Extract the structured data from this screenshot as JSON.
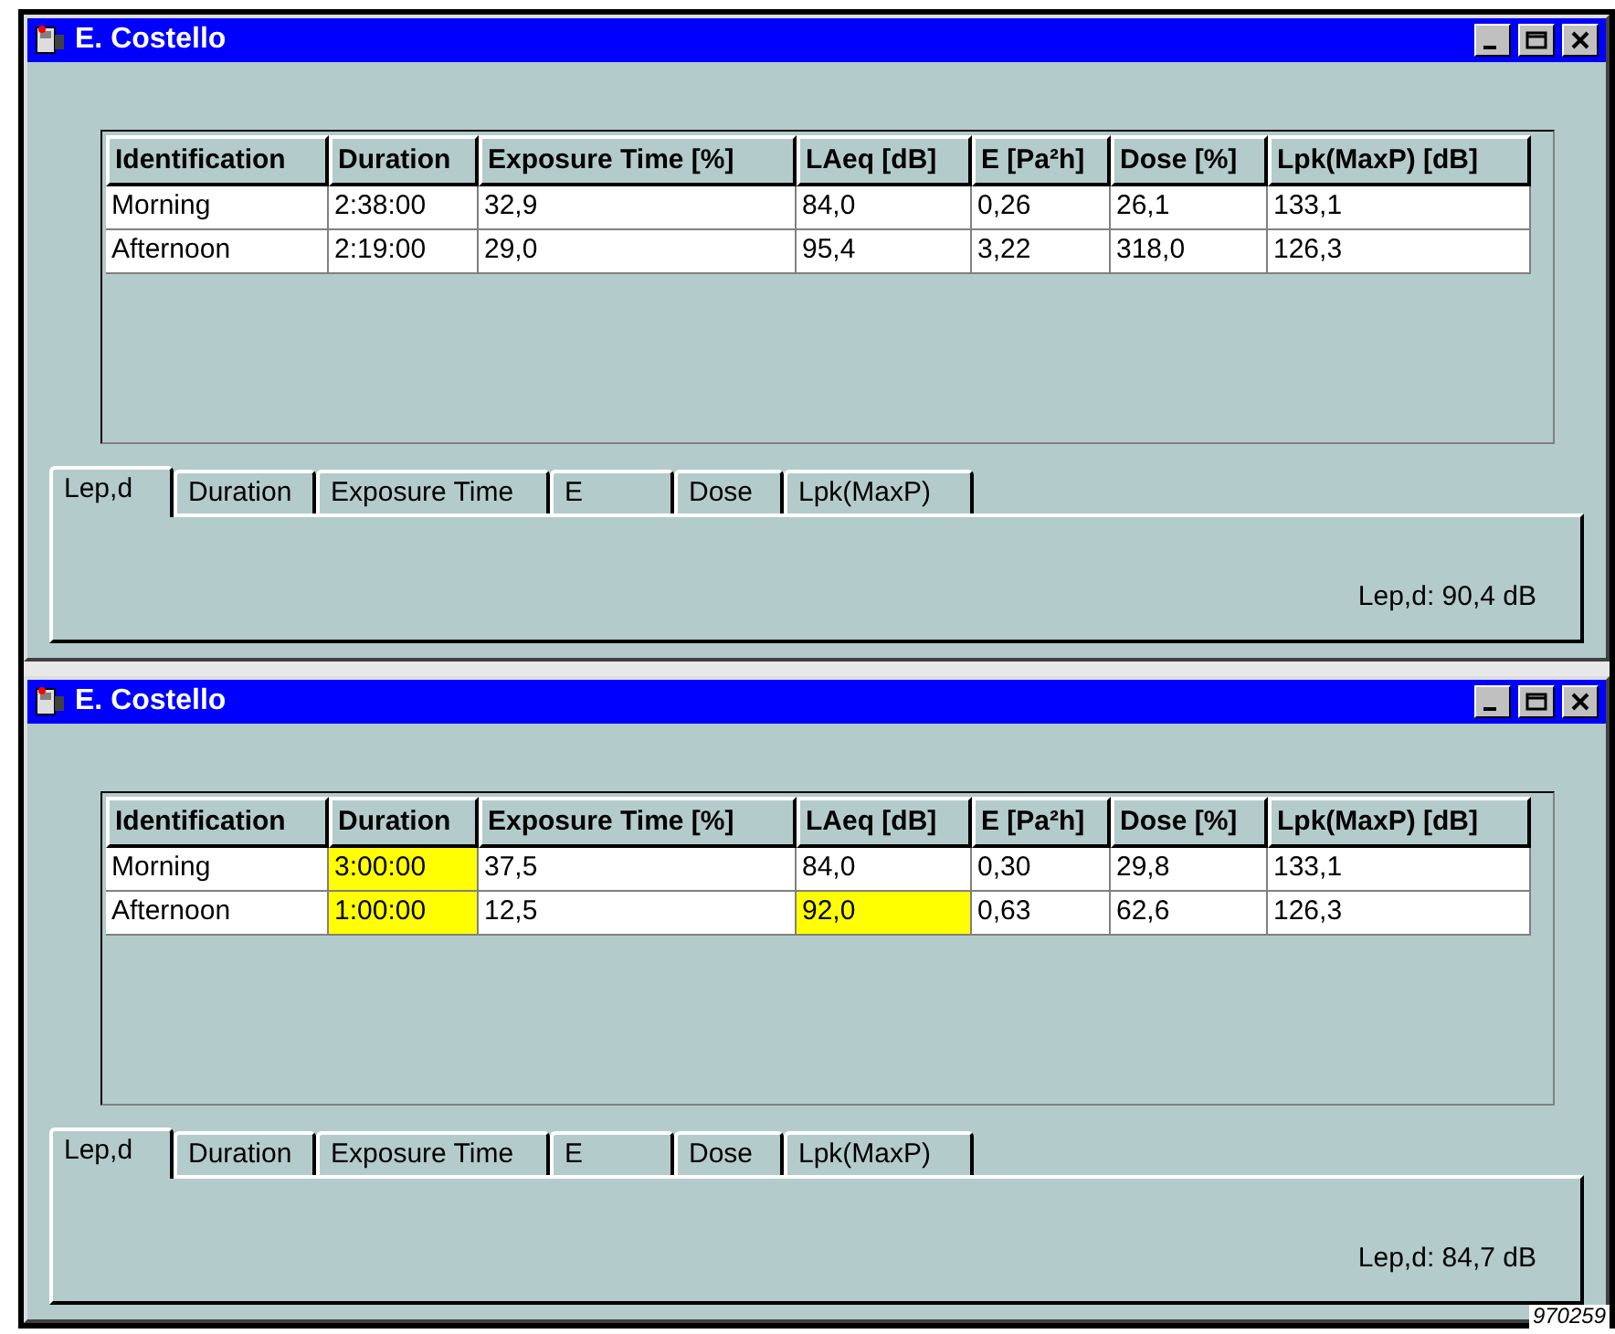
{
  "windows": [
    {
      "title": "E. Costello",
      "table": {
        "columns": [
          "Identification",
          "Duration",
          "Exposure Time [%]",
          "LAeq [dB]",
          "E [Pa²h]",
          "Dose [%]",
          "Lpk(MaxP) [dB]"
        ],
        "rows": [
          {
            "cells": [
              {
                "text": "Morning",
                "highlighted": false
              },
              {
                "text": "2:38:00",
                "highlighted": false
              },
              {
                "text": "32,9",
                "highlighted": false
              },
              {
                "text": "84,0",
                "highlighted": false
              },
              {
                "text": "0,26",
                "highlighted": false
              },
              {
                "text": "26,1",
                "highlighted": false
              },
              {
                "text": "133,1",
                "highlighted": false
              }
            ]
          },
          {
            "cells": [
              {
                "text": "Afternoon",
                "highlighted": false
              },
              {
                "text": "2:19:00",
                "highlighted": false
              },
              {
                "text": "29,0",
                "highlighted": false
              },
              {
                "text": "95,4",
                "highlighted": false
              },
              {
                "text": "3,22",
                "highlighted": false
              },
              {
                "text": "318,0",
                "highlighted": false
              },
              {
                "text": "126,3",
                "highlighted": false
              }
            ]
          }
        ]
      },
      "tabs": [
        {
          "label": "Lep,d",
          "selected": true
        },
        {
          "label": "Duration",
          "selected": false
        },
        {
          "label": "Exposure Time",
          "selected": false
        },
        {
          "label": "E",
          "selected": false
        },
        {
          "label": "Dose",
          "selected": false
        },
        {
          "label": "Lpk(MaxP)",
          "selected": false
        }
      ],
      "result": "Lep,d: 90,4 dB"
    },
    {
      "title": "E. Costello",
      "table": {
        "columns": [
          "Identification",
          "Duration",
          "Exposure Time [%]",
          "LAeq [dB]",
          "E [Pa²h]",
          "Dose [%]",
          "Lpk(MaxP) [dB]"
        ],
        "rows": [
          {
            "cells": [
              {
                "text": "Morning",
                "highlighted": false
              },
              {
                "text": "3:00:00",
                "highlighted": true
              },
              {
                "text": "37,5",
                "highlighted": false
              },
              {
                "text": "84,0",
                "highlighted": false
              },
              {
                "text": "0,30",
                "highlighted": false
              },
              {
                "text": "29,8",
                "highlighted": false
              },
              {
                "text": "133,1",
                "highlighted": false
              }
            ]
          },
          {
            "cells": [
              {
                "text": "Afternoon",
                "highlighted": false
              },
              {
                "text": "1:00:00",
                "highlighted": true
              },
              {
                "text": "12,5",
                "highlighted": false
              },
              {
                "text": "92,0",
                "highlighted": true
              },
              {
                "text": "0,63",
                "highlighted": false
              },
              {
                "text": "62,6",
                "highlighted": false
              },
              {
                "text": "126,3",
                "highlighted": false
              }
            ]
          }
        ]
      },
      "tabs": [
        {
          "label": "Lep,d",
          "selected": true
        },
        {
          "label": "Duration",
          "selected": false
        },
        {
          "label": "Exposure Time",
          "selected": false
        },
        {
          "label": "E",
          "selected": false
        },
        {
          "label": "Dose",
          "selected": false
        },
        {
          "label": "Lpk(MaxP)",
          "selected": false
        }
      ],
      "result": "Lep,d: 84,7 dB"
    }
  ],
  "figure_code": "970259"
}
